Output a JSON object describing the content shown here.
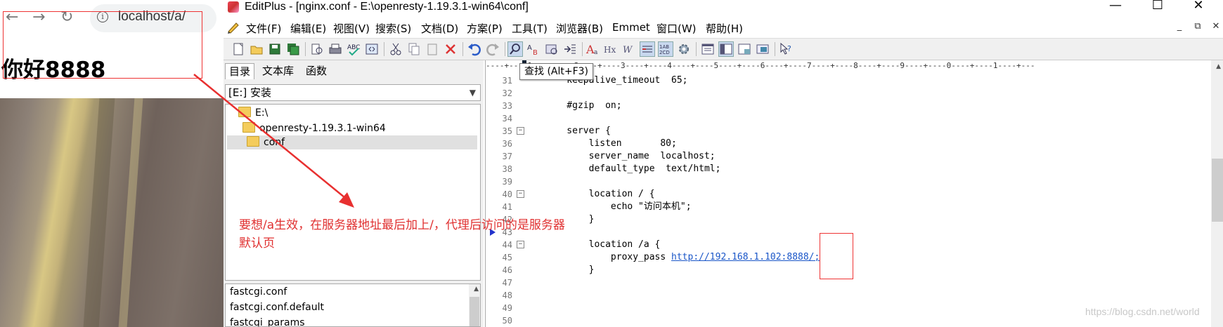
{
  "browser": {
    "back_glyph": "←",
    "forward_glyph": "→",
    "reload_glyph": "↻",
    "info_glyph": "i",
    "address": "localhost/a/",
    "heading": "你好8888"
  },
  "window": {
    "title": "EditPlus - [nginx.conf - E:\\openresty-1.19.3.1-win64\\conf]",
    "minimize": "—",
    "maximize": "☐",
    "close": "✕"
  },
  "menu": {
    "items": [
      "文件(F)",
      "编辑(E)",
      "视图(V)",
      "搜索(S)",
      "文档(D)",
      "方案(P)",
      "工具(T)",
      "浏览器(B)",
      "Emmet",
      "窗口(W)",
      "帮助(H)"
    ],
    "mdi_min": "_",
    "mdi_restore": "⧉",
    "mdi_close": "✕"
  },
  "toolbar": {
    "icons": [
      "new-file-icon",
      "open-file-icon",
      "save-icon",
      "save-all-icon",
      "print-preview-icon",
      "print-icon",
      "spell-check-icon",
      "browser-preview-icon",
      "cut-icon",
      "copy-icon",
      "paste-icon",
      "delete-icon",
      "undo-icon",
      "redo-icon",
      "find-icon",
      "replace-icon",
      "find-in-files-icon",
      "goto-icon",
      "font-icon",
      "hex-icon",
      "word-wrap-icon",
      "line-number-icon",
      "ruler-icon",
      "preferences-icon",
      "directory-window-icon",
      "cliptext-window-icon",
      "output-window-icon",
      "full-screen-icon",
      "help-icon"
    ]
  },
  "dirpanel": {
    "tabs": [
      "目录",
      "文本库",
      "函数"
    ],
    "drive": "[E:] 安装",
    "tree": [
      "E:\\",
      "openresty-1.19.3.1-win64",
      "conf"
    ],
    "files": [
      "fastcgi.conf",
      "fastcgi.conf.default",
      "fastcgi_params"
    ]
  },
  "editor": {
    "ruler": "----+----1----+----2----+----3----+----4----+----5----+----6----+----7----+----8----+----9----+----0----+----1----+---",
    "tooltip": "查找 (Alt+F3)",
    "lines": [
      {
        "n": "31",
        "code": "    keepalive_timeout  65;"
      },
      {
        "n": "32",
        "code": ""
      },
      {
        "n": "33",
        "code": "    #gzip  on;"
      },
      {
        "n": "34",
        "code": ""
      },
      {
        "n": "35",
        "code": "    server {"
      },
      {
        "n": "36",
        "code": "        listen       80;"
      },
      {
        "n": "37",
        "code": "        server_name  localhost;"
      },
      {
        "n": "38",
        "code": "        default_type  text/html;"
      },
      {
        "n": "39",
        "code": ""
      },
      {
        "n": "40",
        "code": "        location / {"
      },
      {
        "n": "41",
        "code": "            echo \"访问本机\";"
      },
      {
        "n": "42",
        "code": "        }"
      },
      {
        "n": "43",
        "code": ""
      },
      {
        "n": "44",
        "code": "        location /a {"
      },
      {
        "n": "45",
        "code": "            proxy_pass "
      },
      {
        "n": "46",
        "code": "        }"
      },
      {
        "n": "47",
        "code": ""
      },
      {
        "n": "48",
        "code": ""
      },
      {
        "n": "49",
        "code": ""
      },
      {
        "n": "50",
        "code": ""
      }
    ],
    "proxy_url": "http://192.168.1.102:8888/;"
  },
  "annotation": {
    "line1": "要想/a生效，在服务器地址最后加上/，代理后访问的是服务器",
    "line2": "默认页"
  },
  "watermark": "https://blog.csdn.net/world",
  "colors": {
    "annotation_red": "#e03030",
    "link_blue": "#1a56c8",
    "folder_yellow": "#f4cc5c"
  }
}
